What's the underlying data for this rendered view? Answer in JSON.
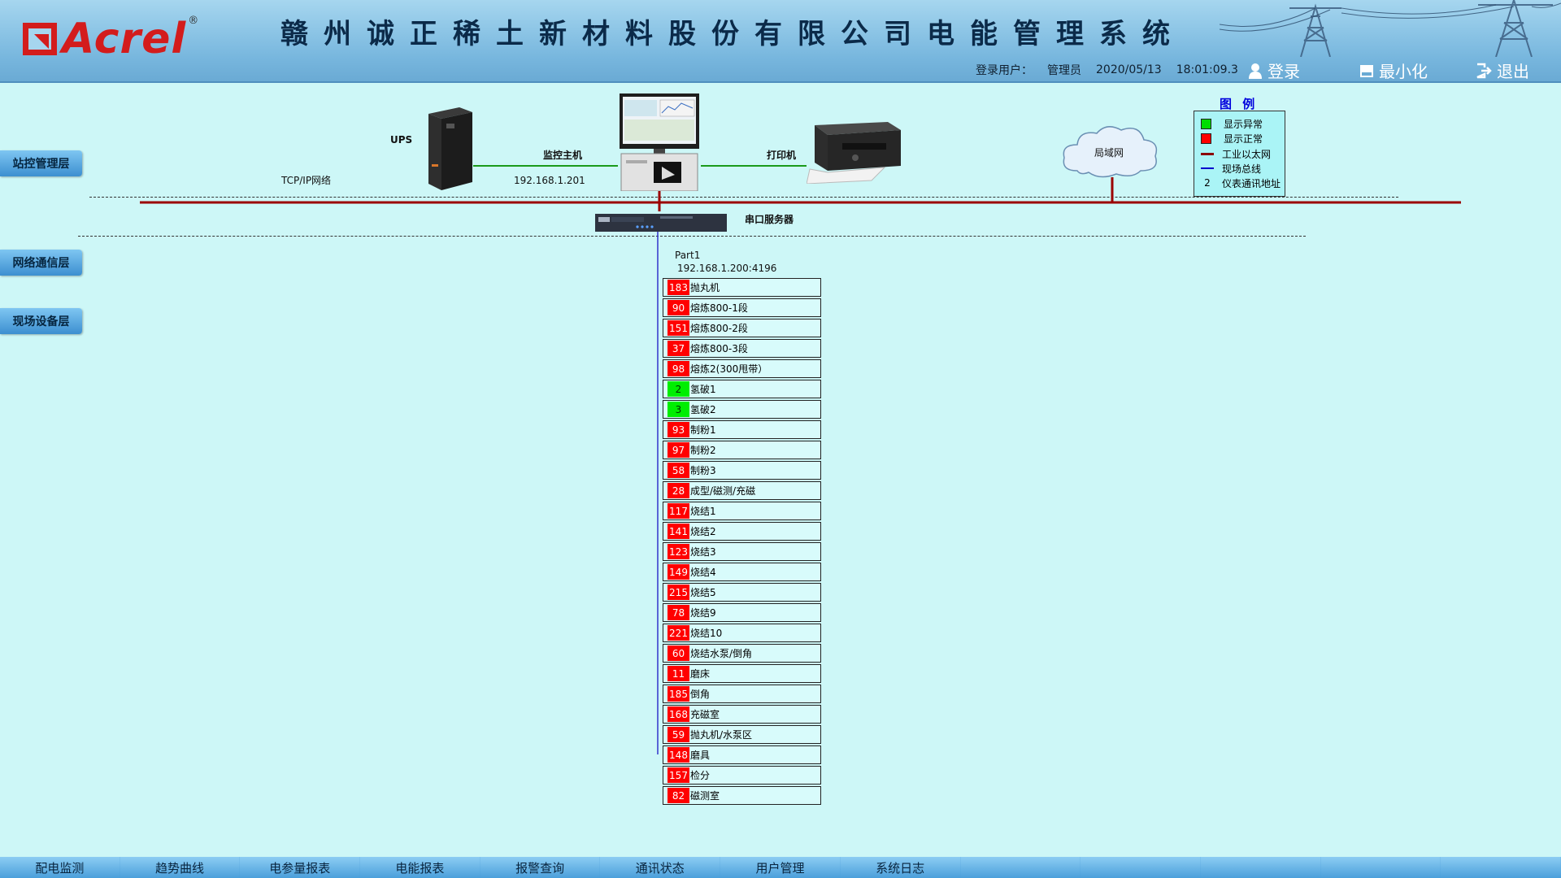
{
  "header": {
    "logo_text": "Acrel",
    "logo_reg": "®",
    "title": "赣州诚正稀土新材料股份有限公司电能管理系统",
    "user_label": "登录用户：",
    "user_name": "管理员",
    "date": "2020/05/13",
    "time": "18:01:09.3",
    "login_label": "登录",
    "minimize_label": "最小化",
    "exit_label": "退出"
  },
  "layers": [
    {
      "label": "站控管理层"
    },
    {
      "label": "网络通信层"
    },
    {
      "label": "现场设备层"
    }
  ],
  "topology": {
    "ups_label": "UPS",
    "tcpip_label": "TCP/IP网络",
    "host_label": "监控主机",
    "host_ip": "192.168.1.201",
    "printer_label": "打印机",
    "lan_label": "局域网",
    "serial_server_label": "串口服务器",
    "port_label": "Part1",
    "port_address": "192.168.1.200:4196"
  },
  "legend": {
    "title": "图 例",
    "items": [
      {
        "label": "显示异常",
        "color": "#00dd00"
      },
      {
        "label": "显示正常",
        "color": "#ff0000"
      },
      {
        "label": "工业以太网",
        "color": "#8b0000"
      },
      {
        "label": "现场总线",
        "color": "#0000cc"
      },
      {
        "label": "仪表通讯地址",
        "symbol": "2"
      }
    ]
  },
  "devices": [
    {
      "id": "183",
      "name": "抛丸机",
      "status": "red"
    },
    {
      "id": "90",
      "name": "熔炼800-1段",
      "status": "red"
    },
    {
      "id": "151",
      "name": "熔炼800-2段",
      "status": "red"
    },
    {
      "id": "37",
      "name": "熔炼800-3段",
      "status": "red"
    },
    {
      "id": "98",
      "name": "熔炼2(300甩带）",
      "status": "red"
    },
    {
      "id": "2",
      "name": "氢破1",
      "status": "green"
    },
    {
      "id": "3",
      "name": "氢破2",
      "status": "green"
    },
    {
      "id": "93",
      "name": "制粉1",
      "status": "red"
    },
    {
      "id": "97",
      "name": "制粉2",
      "status": "red"
    },
    {
      "id": "58",
      "name": "制粉3",
      "status": "red"
    },
    {
      "id": "28",
      "name": "成型/磁测/充磁",
      "status": "red"
    },
    {
      "id": "117",
      "name": "烧结1",
      "status": "red"
    },
    {
      "id": "141",
      "name": "烧结2",
      "status": "red"
    },
    {
      "id": "123",
      "name": "烧结3",
      "status": "red"
    },
    {
      "id": "149",
      "name": "烧结4",
      "status": "red"
    },
    {
      "id": "215",
      "name": "烧结5",
      "status": "red"
    },
    {
      "id": "78",
      "name": "烧结9",
      "status": "red"
    },
    {
      "id": "221",
      "name": "烧结10",
      "status": "red"
    },
    {
      "id": "60",
      "name": "烧结水泵/倒角",
      "status": "red"
    },
    {
      "id": "11",
      "name": "磨床",
      "status": "red"
    },
    {
      "id": "185",
      "name": "倒角",
      "status": "red"
    },
    {
      "id": "168",
      "name": "充磁室",
      "status": "red"
    },
    {
      "id": "59",
      "name": "抛丸机/水泵区",
      "status": "red"
    },
    {
      "id": "148",
      "name": "磨具",
      "status": "red"
    },
    {
      "id": "157",
      "name": "检分",
      "status": "red"
    },
    {
      "id": "82",
      "name": "磁测室",
      "status": "red"
    }
  ],
  "nav": [
    {
      "label": "配电监测"
    },
    {
      "label": "趋势曲线"
    },
    {
      "label": "电参量报表"
    },
    {
      "label": "电能报表"
    },
    {
      "label": "报警查询"
    },
    {
      "label": "通讯状态"
    },
    {
      "label": "用户管理"
    },
    {
      "label": "系统日志"
    },
    {
      "label": ""
    },
    {
      "label": ""
    },
    {
      "label": ""
    },
    {
      "label": ""
    },
    {
      "label": ""
    }
  ],
  "colors": {
    "status_red": "#ff0000",
    "status_green": "#00ee00",
    "ethernet": "#9b0000",
    "fieldbus": "#3333cc",
    "network_green": "#1a9a1a"
  }
}
